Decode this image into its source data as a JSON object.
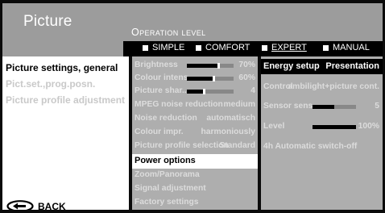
{
  "header": {
    "title": "Picture",
    "operation_level": "Operation level",
    "modes": [
      {
        "label": "SIMPLE",
        "active": false
      },
      {
        "label": "COMFORT",
        "active": false
      },
      {
        "label": "EXPERT",
        "active": true
      },
      {
        "label": "MANUAL",
        "active": false
      }
    ]
  },
  "left_menu": {
    "items": [
      {
        "label": "Picture settings, general",
        "selected": true
      },
      {
        "label": "Pict.set.,prog.posn.",
        "selected": false
      },
      {
        "label": "Picture profile adjustment",
        "selected": false
      }
    ],
    "back_label": "BACK",
    "back_icon": "back-arrow-icon"
  },
  "middle_menu": {
    "items": [
      {
        "label": "Brightness",
        "value": "70%",
        "level": 0.7
      },
      {
        "label": "Colour intens.",
        "value": "60%",
        "level": 0.6
      },
      {
        "label": "Picture shar...",
        "value": "4",
        "level": 0.4
      },
      {
        "label": "MPEG noise reduction",
        "value": "medium"
      },
      {
        "label": "Noise reduction",
        "value": "automatisch"
      },
      {
        "label": "Colour impr.",
        "value": "harmoniously"
      },
      {
        "label": "Picture profile selection",
        "value": "Standard"
      },
      {
        "label": "Power options",
        "value": "",
        "selected": true
      },
      {
        "label": "Zoom/Panorama",
        "value": ""
      },
      {
        "label": "Signal adjustment",
        "value": ""
      },
      {
        "label": "Factory settings",
        "value": ""
      }
    ]
  },
  "right_menu": {
    "items": [
      {
        "label": "Energy setup",
        "value": "Presentation",
        "selected": true
      },
      {
        "label": "Control",
        "value": "ambilight+picture cont."
      },
      {
        "label": "Sensor sens...",
        "value": "5",
        "level": 0.5
      },
      {
        "label": "Level",
        "value": "100%",
        "level": 1.0
      },
      {
        "label": "4h Automatic switch-off",
        "value": ""
      }
    ]
  },
  "colors": {
    "header_bg": "#9c9c9c",
    "panel_bg": "#aeaeae",
    "selection_white": "#ffffff",
    "selection_black": "#000000"
  }
}
